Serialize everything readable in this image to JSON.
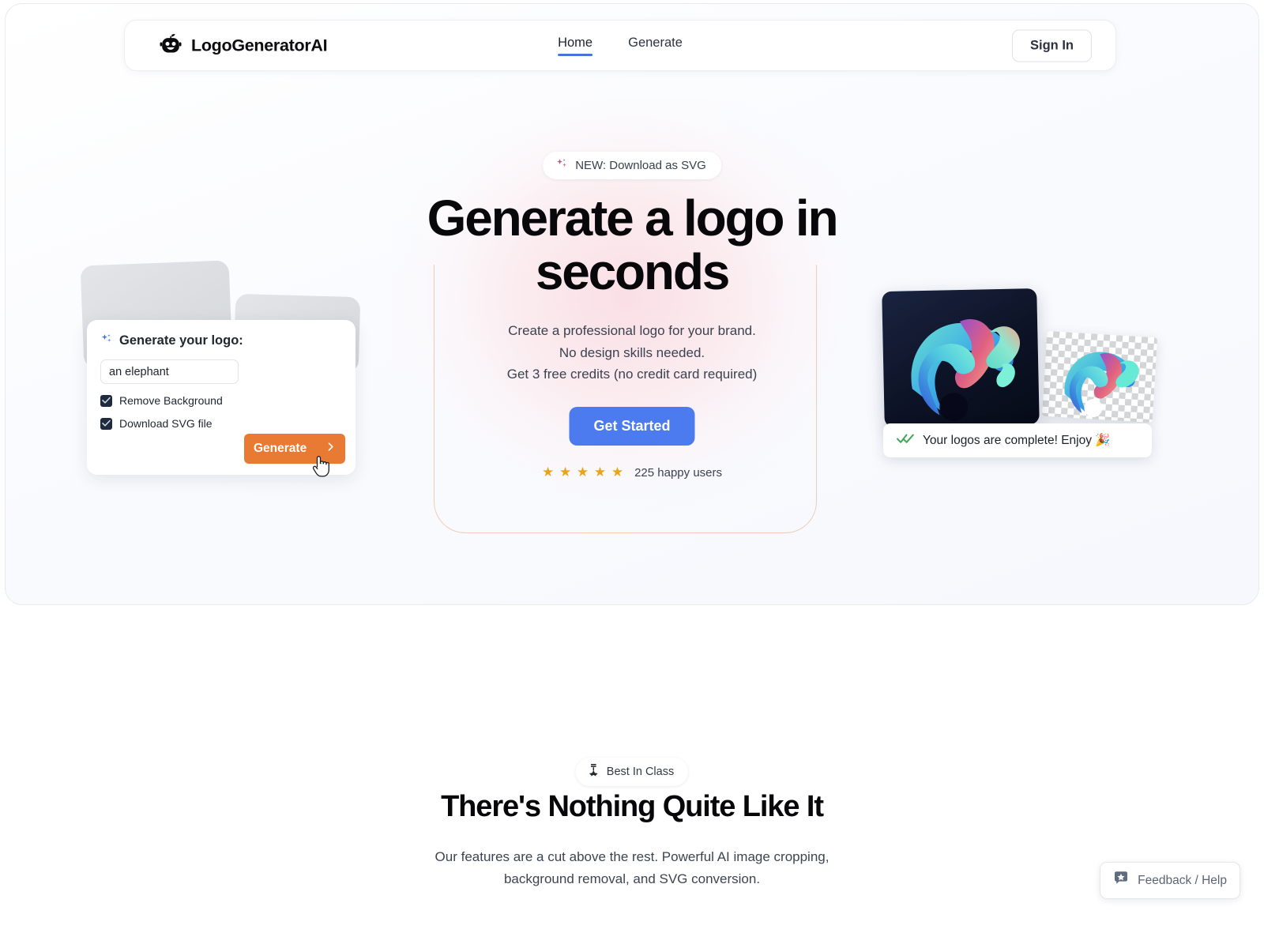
{
  "navbar": {
    "brand": {
      "name": "LogoGeneratorAI",
      "icon": "robot-head-icon"
    },
    "links": [
      {
        "label": "Home",
        "active": true
      },
      {
        "label": "Generate",
        "active": false
      }
    ],
    "signin_label": "Sign In"
  },
  "hero": {
    "badge": {
      "text": "NEW: Download as SVG",
      "icon": "sparkles-icon"
    },
    "title": "Generate a logo in seconds",
    "subtitle": "Create a professional logo for your brand.\nNo design skills needed.\nGet 3 free credits (no credit card required)",
    "cta_label": "Get Started",
    "stars": "★ ★ ★ ★ ★",
    "happy_users": "225 happy users"
  },
  "generator_card": {
    "title": "Generate your logo:",
    "title_icon": "sparkles-icon",
    "prompt_value": "an elephant",
    "prompt_placeholder": "an elephant",
    "options": [
      {
        "label": "Remove Background",
        "checked": true
      },
      {
        "label": "Download SVG file",
        "checked": true
      }
    ],
    "generate_label": "Generate",
    "generate_icon": "chevron-right-icon",
    "cursor": "pointing-hand-cursor"
  },
  "preview": {
    "toast_text": "Your logos are complete! Enjoy 🎉",
    "toast_icon": "double-check-icon",
    "image_dark_alt": "generated elephant logo on dark background",
    "image_transparent_alt": "generated elephant logo on transparent checkerboard background"
  },
  "features": {
    "badge": {
      "text": "Best In Class",
      "icon": "medal-icon"
    },
    "title": "There's Nothing Quite Like It",
    "subtitle": "Our features are a cut above the rest. Powerful AI image cropping, background removal, and SVG conversion."
  },
  "feedback": {
    "label": "Feedback / Help",
    "icon": "star-bubble-icon"
  },
  "colors": {
    "accent_blue": "#4b7bef",
    "accent_orange": "#e87a33",
    "nav_underline": "#4a73d8",
    "star_gold": "#e9a519",
    "checkbox_navy": "#1e2a3d",
    "toast_green": "#3fa656",
    "hero_glow_pink": "#fadee4"
  }
}
